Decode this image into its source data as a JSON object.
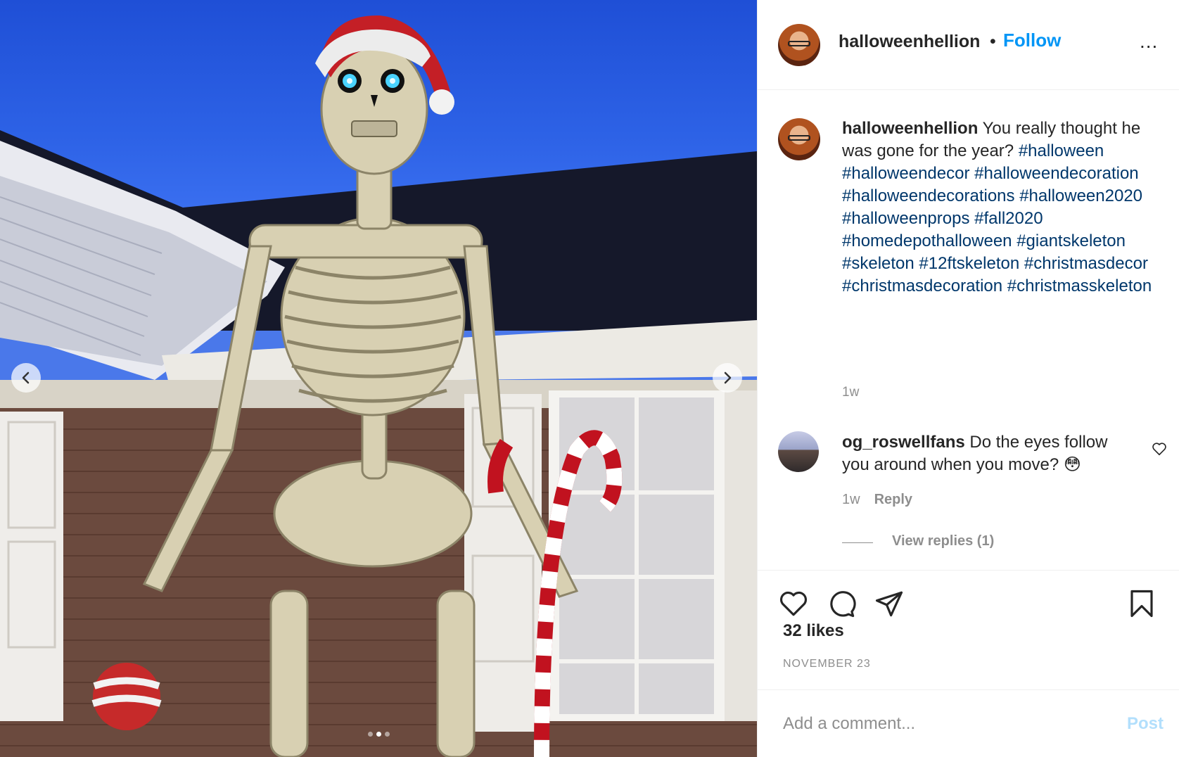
{
  "post": {
    "username": "halloweenhellion",
    "separator": "•",
    "follow_label": "Follow",
    "more_label": "...",
    "caption_text": " You really thought he was gone for the year? ",
    "hashtags": [
      "#halloween",
      "#halloweendecor",
      "#halloweendecoration",
      "#halloweendecorations",
      "#halloween2020",
      "#halloweenprops",
      "#fall2020",
      "#homedepothalloween",
      "#giantskeleton",
      "#skeleton",
      "#12ftskeleton",
      "#christmasdecor",
      "#christmasdecoration",
      "#christmasskeleton"
    ],
    "caption_time": "1w"
  },
  "comment": {
    "username": "og_roswellfans",
    "text": " Do the eyes follow you around when you move? 😳",
    "time": "1w",
    "reply_label": "Reply",
    "view_replies_label": "View replies (1)"
  },
  "actions": {
    "icons": [
      "heart-icon",
      "comment-icon",
      "share-icon",
      "bookmark-icon"
    ],
    "likes": "32 likes",
    "date": "NOVEMBER 23"
  },
  "add_comment": {
    "placeholder": "Add a comment...",
    "post_label": "Post"
  },
  "media": {
    "slides_total": 3,
    "slide_active": 2,
    "icons": [
      "chevron-left-icon",
      "chevron-right-icon"
    ]
  },
  "colors": {
    "follow": "#0095f6",
    "hashtag": "#00376b",
    "muted": "#8e8e8e",
    "post_disabled": "#b2dffc",
    "sky": "#3a6ff0"
  }
}
